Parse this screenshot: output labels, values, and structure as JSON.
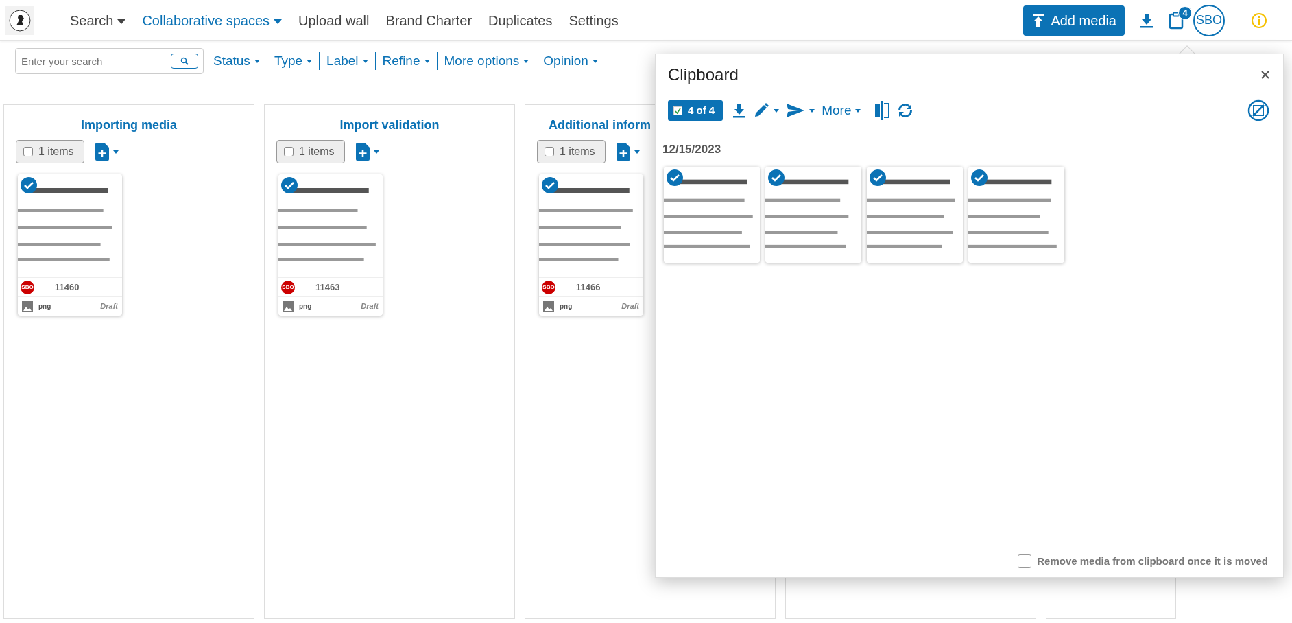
{
  "nav": {
    "items": [
      {
        "label": "Search",
        "dropdown": true,
        "selected": false
      },
      {
        "label": "Collaborative spaces",
        "dropdown": true,
        "selected": true
      },
      {
        "label": "Upload wall",
        "dropdown": false,
        "selected": false
      },
      {
        "label": "Brand Charter",
        "dropdown": false,
        "selected": false
      },
      {
        "label": "Duplicates",
        "dropdown": false,
        "selected": false
      },
      {
        "label": "Settings",
        "dropdown": false,
        "selected": false
      }
    ]
  },
  "actions": {
    "add_media": "Add media",
    "clipboard_count": "4",
    "user": "SBO"
  },
  "search": {
    "placeholder": "Enter your search"
  },
  "filters": [
    "Status",
    "Type",
    "Label",
    "Refine",
    "More options",
    "Opinion"
  ],
  "columns": [
    {
      "title": "Importing media",
      "count": "1 items",
      "checked": false,
      "media": [
        {
          "id": "11460",
          "owner": "SBO",
          "format": "png",
          "status": "Draft",
          "selected": true
        }
      ]
    },
    {
      "title": "Import validation",
      "count": "1 items",
      "checked": false,
      "media": [
        {
          "id": "11463",
          "owner": "SBO",
          "format": "png",
          "status": "Draft",
          "selected": true
        }
      ]
    },
    {
      "title": "Additional inform",
      "count": "1 items",
      "checked": false,
      "media": [
        {
          "id": "11466",
          "owner": "SBO",
          "format": "png",
          "status": "Draft",
          "selected": true
        }
      ]
    }
  ],
  "clipboard": {
    "title": "Clipboard",
    "selection": "4 of 4",
    "more": "More",
    "date": "12/15/2023",
    "items": [
      {
        "selected": true
      },
      {
        "selected": true
      },
      {
        "selected": true
      },
      {
        "selected": true
      }
    ],
    "remove_option": {
      "label": "Remove media from clipboard once it is moved",
      "checked": false
    }
  }
}
